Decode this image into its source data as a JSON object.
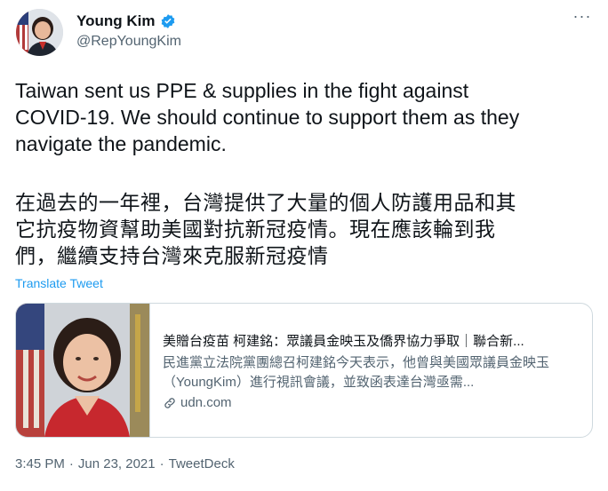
{
  "author": {
    "display_name": "Young Kim",
    "handle": "@RepYoungKim",
    "verified_icon": "verified-badge-icon",
    "verified_color": "#1d9bf0"
  },
  "more_icon": "more-horizontal-icon",
  "more_glyph": "···",
  "tweet": {
    "text_en": "Taiwan sent us PPE & supplies in the fight against\nCOVID-19. We should continue to support them as they\nnavigate the pandemic.",
    "text_zh": "在過去的一年裡，台灣提供了大量的個人防護用品和其\n它抗疫物資幫助美國對抗新冠疫情。現在應該輪到我\n們，繼續支持台灣來克服新冠疫情",
    "translate_label": "Translate Tweet"
  },
  "card": {
    "title": "美贈台疫苗 柯建銘：眾議員金映玉及僑界協力爭取｜聯合新...",
    "description": "民進黨立法院黨團總召柯建銘今天表示，他曾與美國眾議員金映玉（YoungKim）進行視訊會議，並致函表達台灣亟需...",
    "domain": "udn.com",
    "link_icon": "link-icon"
  },
  "meta": {
    "time": "3:45 PM",
    "separator": "·",
    "date": "Jun 23, 2021",
    "source": "TweetDeck"
  },
  "colors": {
    "accent": "#1d9bf0",
    "text_primary": "#0f1419",
    "text_secondary": "#536471",
    "border": "#cfd9de"
  }
}
